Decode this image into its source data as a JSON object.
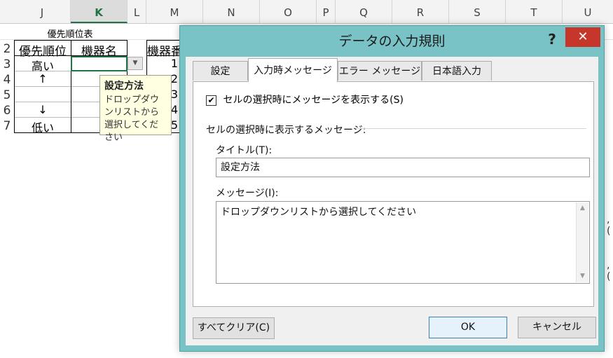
{
  "sheet": {
    "columns": [
      "J",
      "K",
      "L",
      "M",
      "N",
      "O",
      "P",
      "Q",
      "R",
      "S",
      "T",
      "U"
    ],
    "selected_column": "K",
    "row_numbers": [
      "2",
      "3",
      "4",
      "5",
      "6",
      "7"
    ],
    "table_title": "優先順位表",
    "headers": {
      "priority": "優先順位",
      "device": "機器名",
      "device2": "機器番"
    },
    "priority_cells": [
      "高い",
      "↑",
      "",
      "↓",
      "低い"
    ],
    "m_values": [
      "1",
      "2",
      "3",
      "4",
      "5"
    ],
    "dropdown_icon": "triangle-down-icon",
    "tooltip": {
      "title": "設定方法",
      "message": "ドロップダウンリストから選択してください"
    },
    "right_marks": [
      ",(",
      ",("
    ]
  },
  "dialog": {
    "title": "データの入力規則",
    "help_label": "?",
    "close_label": "✕",
    "tabs": [
      {
        "label": "設定",
        "active": false
      },
      {
        "label": "入力時メッセージ",
        "active": true
      },
      {
        "label": "エラー メッセージ",
        "active": false
      },
      {
        "label": "日本語入力",
        "active": false
      }
    ],
    "show_message_checkbox": {
      "checked": true,
      "label": "セルの選択時にメッセージを表示する(S)"
    },
    "section_label": "セルの選択時に表示するメッセージ:",
    "title_label": "タイトル(T):",
    "title_value": "設定方法",
    "message_label": "メッセージ(I):",
    "message_value": "ドロップダウンリストから選択してください",
    "buttons": {
      "clear_all": "すべてクリア(C)",
      "ok": "OK",
      "cancel": "キャンセル"
    }
  }
}
